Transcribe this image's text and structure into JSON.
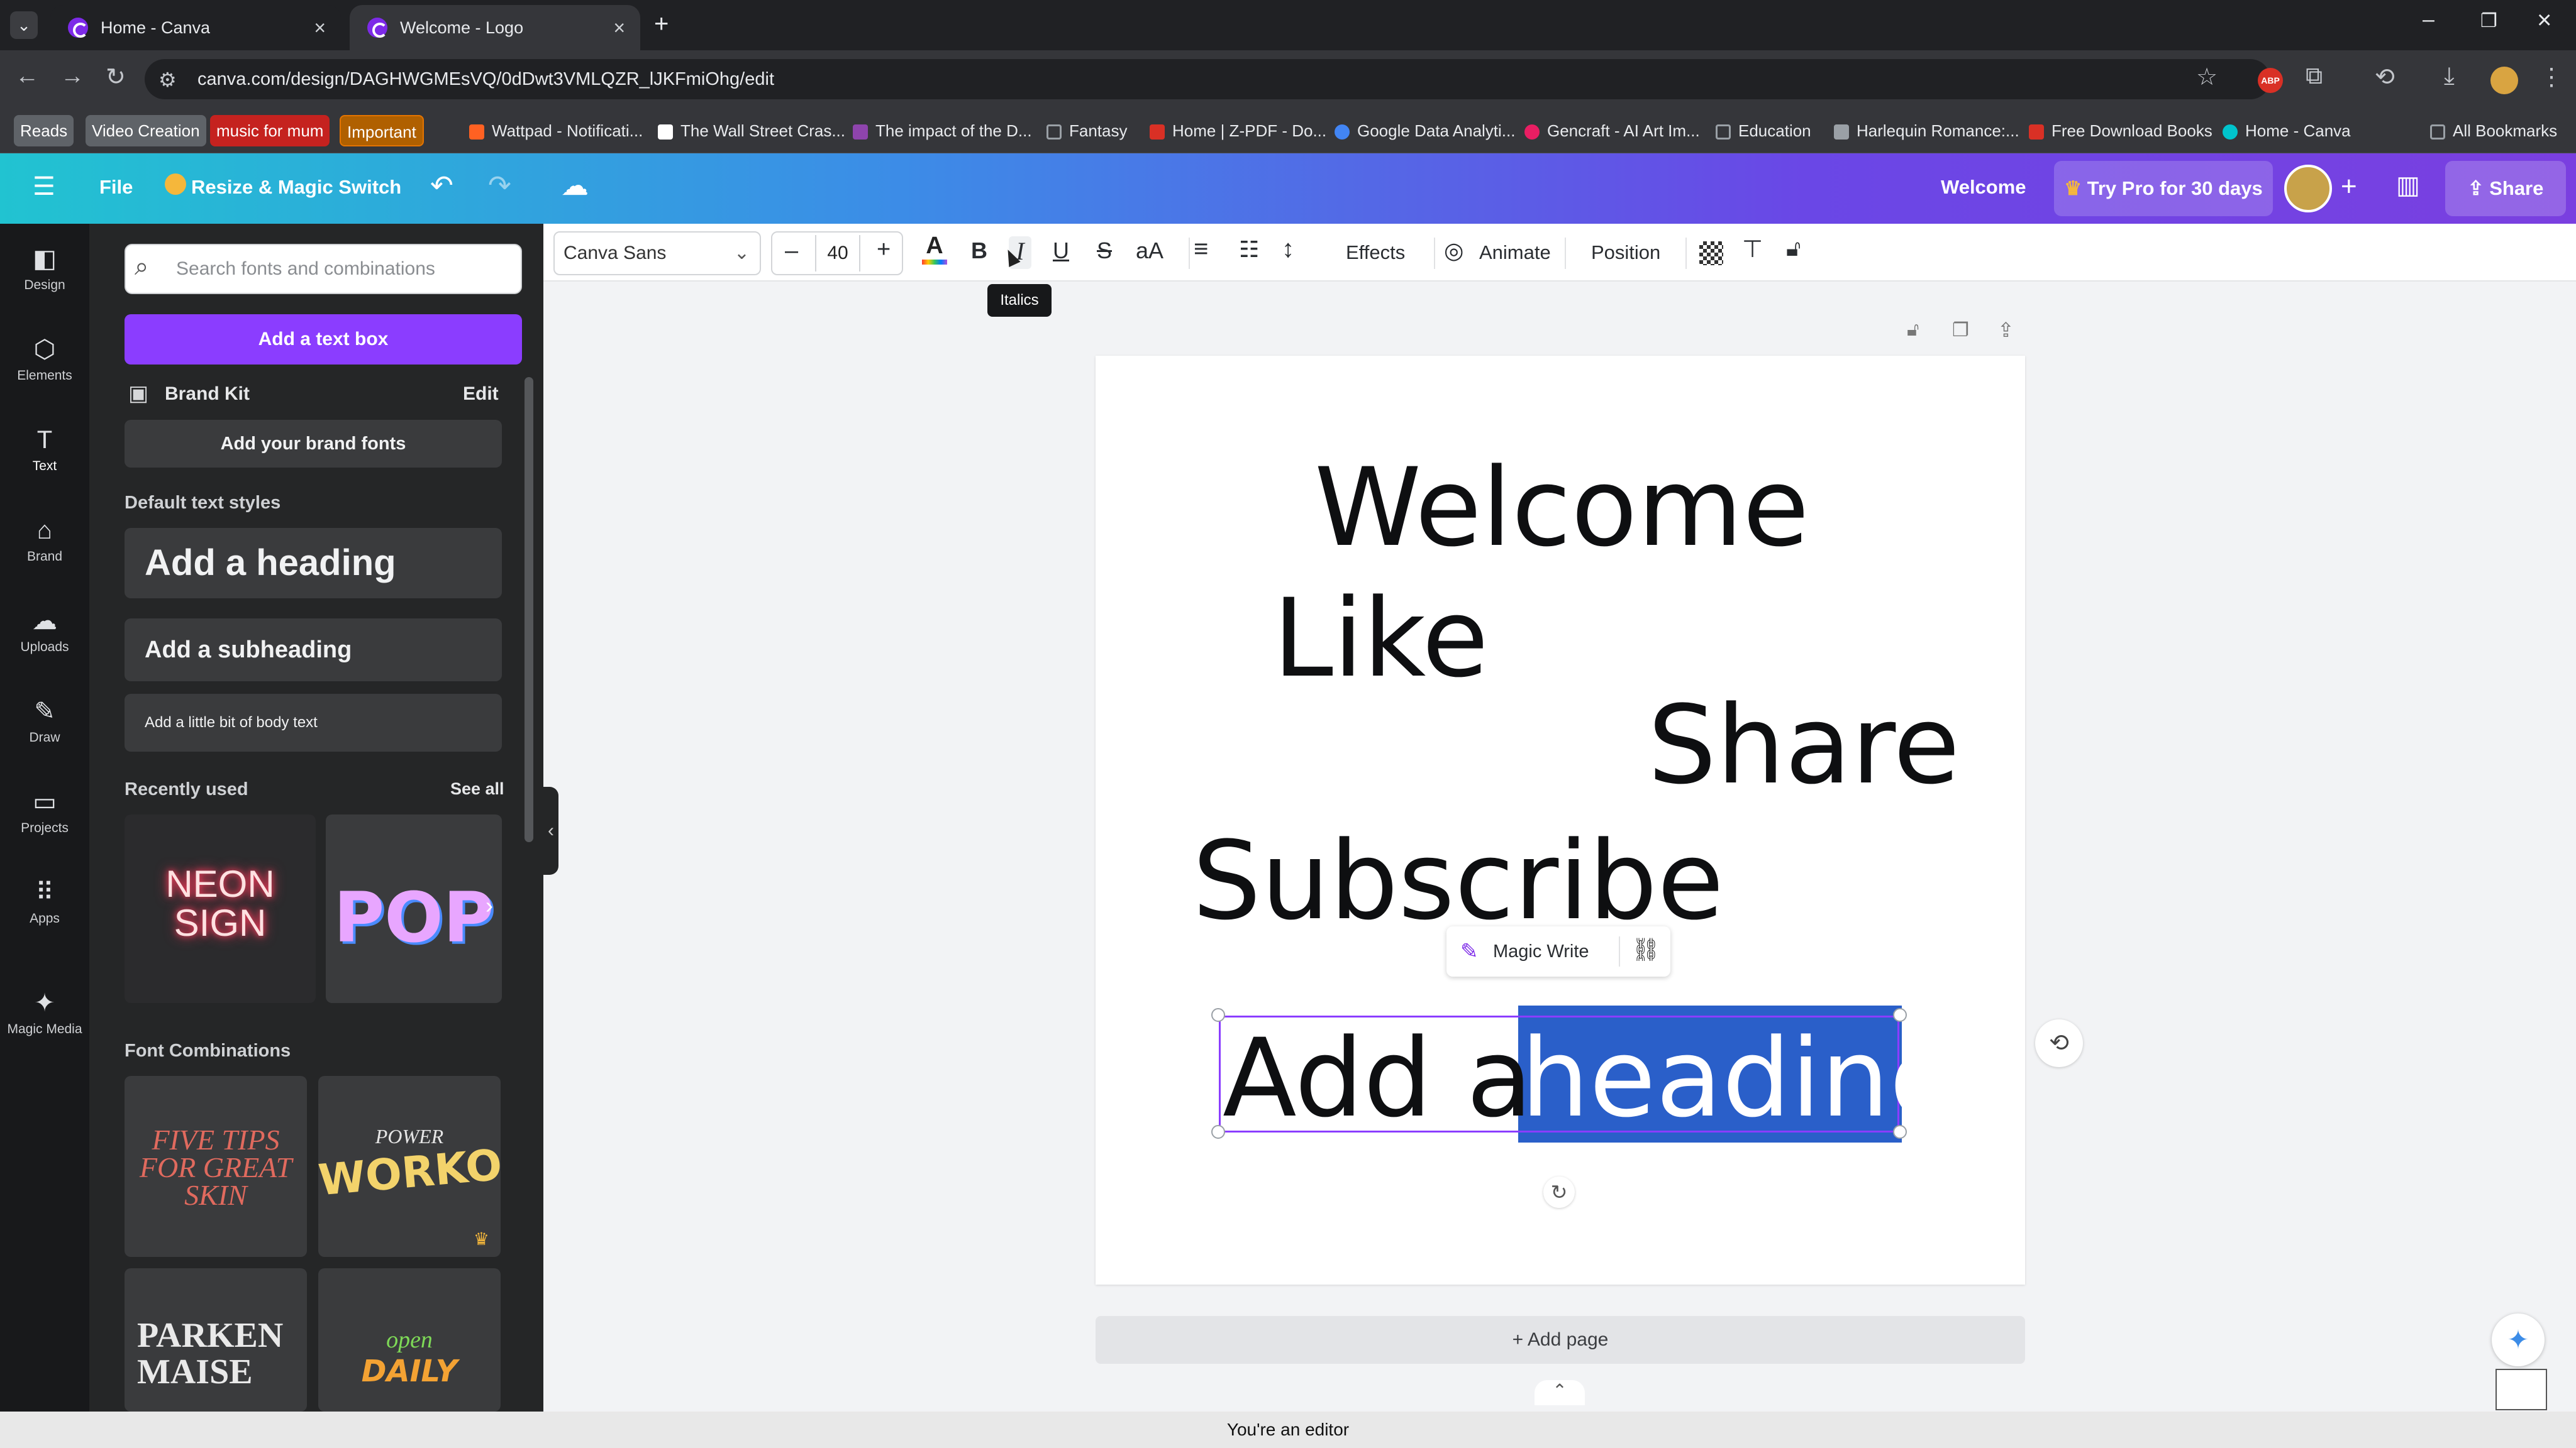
{
  "browser": {
    "tabs": [
      {
        "label": "Home - Canva",
        "active": false
      },
      {
        "label": "Welcome - Logo",
        "active": true
      }
    ],
    "url": "canva.com/design/DAGHWGMEsVQ/0dDwt3VMLQZR_lJKFmiOhg/edit",
    "bookmarks": [
      {
        "label": "Reads",
        "color": "#5f6368"
      },
      {
        "label": "Video Creation",
        "color": "#5f6368"
      },
      {
        "label": "music for mum",
        "color": "#c5221f"
      },
      {
        "label": "Important",
        "color": "#e37400"
      },
      {
        "label": "Wattpad - Notificati...",
        "color": "#ff6122"
      },
      {
        "label": "The Wall Street Cras...",
        "color": "#ffffff"
      },
      {
        "label": "The impact of the D...",
        "color": "#8e44ad"
      },
      {
        "label": "Fantasy",
        "color": "#9aa0a6"
      },
      {
        "label": "Home | Z-PDF - Do...",
        "color": "#d93025"
      },
      {
        "label": "Google Data Analyti...",
        "color": "#4285f4"
      },
      {
        "label": "Gencraft - AI Art Im...",
        "color": "#e91e63"
      },
      {
        "label": "Education",
        "color": "#9aa0a6"
      },
      {
        "label": "Harlequin Romance:...",
        "color": "#9aa0a6"
      },
      {
        "label": "Free Download Books",
        "color": "#d93025"
      },
      {
        "label": "Home - Canva",
        "color": "#00c4cc"
      },
      {
        "label": "All Bookmarks",
        "color": "#9aa0a6"
      }
    ]
  },
  "topbar": {
    "file": "File",
    "resize": "Resize & Magic Switch",
    "title": "Welcome",
    "try_pro": "Try Pro for 30 days",
    "share": "Share"
  },
  "rail": [
    {
      "label": "Design",
      "icon": "design-icon",
      "glyph": "◧"
    },
    {
      "label": "Elements",
      "icon": "elements-icon",
      "glyph": "⬡"
    },
    {
      "label": "Text",
      "icon": "text-icon",
      "glyph": "T"
    },
    {
      "label": "Brand",
      "icon": "brand-icon",
      "glyph": "⌂"
    },
    {
      "label": "Uploads",
      "icon": "uploads-icon",
      "glyph": "☁"
    },
    {
      "label": "Draw",
      "icon": "draw-icon",
      "glyph": "✎"
    },
    {
      "label": "Projects",
      "icon": "projects-icon",
      "glyph": "▭"
    },
    {
      "label": "Apps",
      "icon": "apps-icon",
      "glyph": "⠿"
    },
    {
      "label": "Magic Media",
      "icon": "magic-media-icon",
      "glyph": "✦"
    }
  ],
  "panel": {
    "search_placeholder": "Search fonts and combinations",
    "add_text_box": "Add a text box",
    "brand_kit": "Brand Kit",
    "edit": "Edit",
    "add_brand_fonts": "Add your brand fonts",
    "default_styles": "Default text styles",
    "heading": "Add a heading",
    "subheading": "Add a subheading",
    "body": "Add a little bit of body text",
    "recently_used": "Recently used",
    "see_all": "See all",
    "neon": "NEON SIGN",
    "pop": "POP",
    "font_combinations": "Font Combinations",
    "combo1": "FIVE TIPS FOR GREAT SKIN",
    "combo2_top": "POWER",
    "combo2": "WORKOUT",
    "combo3": "PARKEN MAISE",
    "combo4_top": "open",
    "combo4": "DAILY"
  },
  "toolbar": {
    "font": "Canva Sans",
    "size": "40",
    "effects": "Effects",
    "animate": "Animate",
    "position": "Position",
    "tooltip": "Italics"
  },
  "canvas": {
    "words": [
      "Welcome",
      "Like",
      "Share",
      "Subscribe"
    ],
    "sel_part1": "Add a ",
    "sel_part2": "heading",
    "magic_write": "Magic Write",
    "add_page": "+ Add page"
  },
  "footer": "You're an editor"
}
